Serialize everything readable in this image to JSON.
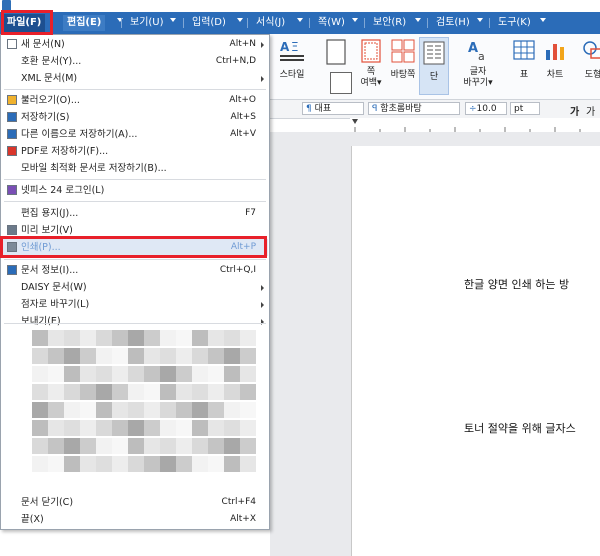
{
  "menubar": {
    "items": [
      {
        "label": "파일(F)",
        "chev": false
      },
      {
        "label": "편집(E)",
        "chev": true
      },
      {
        "label": "보기(U)",
        "chev": true
      },
      {
        "label": "입력(D)",
        "chev": true
      },
      {
        "label": "서식(J)",
        "chev": true
      },
      {
        "label": "쪽(W)",
        "chev": true
      },
      {
        "label": "보안(R)",
        "chev": true
      },
      {
        "label": "검토(H)",
        "chev": true
      },
      {
        "label": "도구(K)",
        "chev": true
      }
    ]
  },
  "ribbon": {
    "style_label": "스타일",
    "margin_label": "쪽\n여백▾",
    "bg_label": "바탕쪽",
    "col_label": "단",
    "char_change_label": "글자\n바꾸기▾",
    "table_label": "표",
    "chart_label": "차트",
    "shape_label": "도형"
  },
  "fmtbar": {
    "style_value": "대표",
    "font_value": "함초롬바탕",
    "size_value": "10.0",
    "unit_value": "pt",
    "bold_sample": "가",
    "italic_sample": "가"
  },
  "filemenu": {
    "items": [
      {
        "icon": "new-doc-icon",
        "label": "새 문서(N)",
        "shortcut": "Alt+N",
        "arrow": true,
        "highlight": false
      },
      {
        "icon": "",
        "label": "호환 문서(Y)...",
        "shortcut": "Ctrl+N,D",
        "arrow": false,
        "highlight": false
      },
      {
        "icon": "",
        "label": "XML 문서(M)",
        "shortcut": "",
        "arrow": true,
        "highlight": false
      },
      {
        "icon": "folder-open-icon",
        "label": "불러오기(O)...",
        "shortcut": "Alt+O",
        "arrow": false,
        "highlight": false
      },
      {
        "icon": "save-icon",
        "label": "저장하기(S)",
        "shortcut": "Alt+S",
        "arrow": false,
        "highlight": false
      },
      {
        "icon": "save-as-icon",
        "label": "다른 이름으로 저장하기(A)...",
        "shortcut": "Alt+V",
        "arrow": false,
        "highlight": false
      },
      {
        "icon": "pdf-icon",
        "label": "PDF로 저장하기(F)...",
        "shortcut": "",
        "arrow": false,
        "highlight": false
      },
      {
        "icon": "",
        "label": "모바일 최적화 문서로 저장하기(B)...",
        "shortcut": "",
        "arrow": false,
        "highlight": false
      },
      {
        "icon": "netffice-icon",
        "label": "넷피스 24 로그인(L)",
        "shortcut": "",
        "arrow": false,
        "highlight": false
      },
      {
        "icon": "",
        "label": "편집 용지(J)...",
        "shortcut": "F7",
        "arrow": false,
        "highlight": false
      },
      {
        "icon": "preview-icon",
        "label": "미리 보기(V)",
        "shortcut": "",
        "arrow": false,
        "highlight": false
      },
      {
        "icon": "printer-icon",
        "label": "인쇄(P)...",
        "shortcut": "Alt+P",
        "arrow": false,
        "highlight": true
      },
      {
        "icon": "doc-info-icon",
        "label": "문서 정보(I)...",
        "shortcut": "Ctrl+Q,I",
        "arrow": false,
        "highlight": false
      },
      {
        "icon": "",
        "label": "DAISY 문서(W)",
        "shortcut": "",
        "arrow": true,
        "highlight": false
      },
      {
        "icon": "",
        "label": "점자로 바꾸기(L)",
        "shortcut": "",
        "arrow": true,
        "highlight": false
      },
      {
        "icon": "",
        "label": "보내기(E)",
        "shortcut": "",
        "arrow": true,
        "highlight": false
      },
      {
        "icon": "",
        "label": "문서 닫기(C)",
        "shortcut": "Ctrl+F4",
        "arrow": false,
        "highlight": false
      },
      {
        "icon": "",
        "label": "끝(X)",
        "shortcut": "Alt+X",
        "arrow": false,
        "highlight": false
      }
    ]
  },
  "document": {
    "line1": "한글 양면 인쇄 하는 방",
    "line2": "토너 절약을 위해 글자스"
  },
  "colors": {
    "menubar": "#2b6cb8",
    "highlight": "#dfe8f5",
    "highlight_text": "#6f9bd4",
    "annotation_red": "#e8202a"
  }
}
